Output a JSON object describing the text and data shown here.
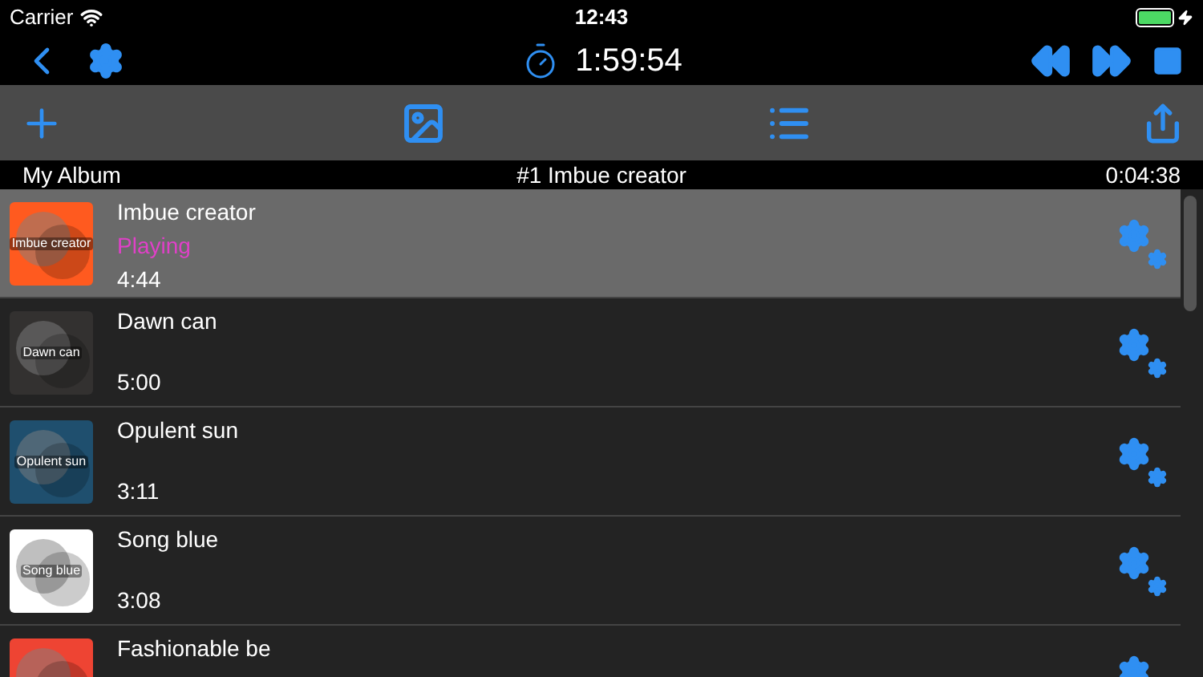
{
  "status_bar": {
    "carrier": "Carrier",
    "time": "12:43"
  },
  "player": {
    "elapsed": "1:59:54"
  },
  "now_playing": {
    "album": "My Album",
    "track": "#1 Imbue creator",
    "duration": "0:04:38"
  },
  "songs": [
    {
      "title": "Imbue creator",
      "status": "Playing",
      "duration": "4:44",
      "art_label": "Imbue creator",
      "color": "#ff5a1f",
      "selected": true
    },
    {
      "title": "Dawn can",
      "duration": "5:00",
      "art_label": "Dawn can",
      "color": "#333130",
      "selected": false
    },
    {
      "title": "Opulent sun",
      "duration": "3:11",
      "art_label": "Opulent sun",
      "color": "#1f4f6e",
      "selected": false
    },
    {
      "title": "Song blue",
      "duration": "3:08",
      "art_label": "Song blue",
      "color": "#ffffff",
      "selected": false
    },
    {
      "title": "Fashionable be",
      "color": "#ee4433",
      "selected": false
    }
  ]
}
